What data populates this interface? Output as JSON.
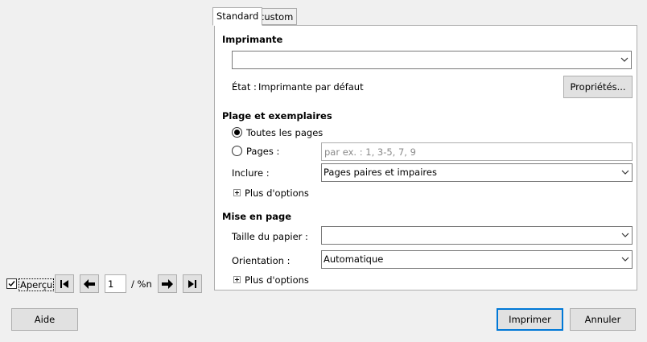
{
  "tabs": [
    {
      "label": "Standard",
      "active": true
    },
    {
      "label": "custom",
      "active": false
    }
  ],
  "printer": {
    "section_title": "Imprimante",
    "selected": "",
    "status_label": "État :",
    "status_value": "Imprimante par défaut",
    "properties_button": "Propriétés..."
  },
  "range": {
    "section_title": "Plage et exemplaires",
    "all_pages_label": "Toutes les pages",
    "pages_label": "Pages :",
    "pages_placeholder": "par ex. : 1, 3-5, 7, 9",
    "include_label": "Inclure :",
    "include_value": "Pages paires et impaires",
    "more_options": "Plus d'options"
  },
  "layout": {
    "section_title": "Mise en page",
    "paper_size_label": "Taille du papier :",
    "paper_size_value": "",
    "orientation_label": "Orientation :",
    "orientation_value": "Automatique",
    "more_options": "Plus d'options"
  },
  "preview": {
    "checkbox_label": "Aperçu",
    "checked": true,
    "page_number": "1",
    "page_total": "/ %n"
  },
  "footer": {
    "help": "Aide",
    "print": "Imprimer",
    "cancel": "Annuler"
  }
}
